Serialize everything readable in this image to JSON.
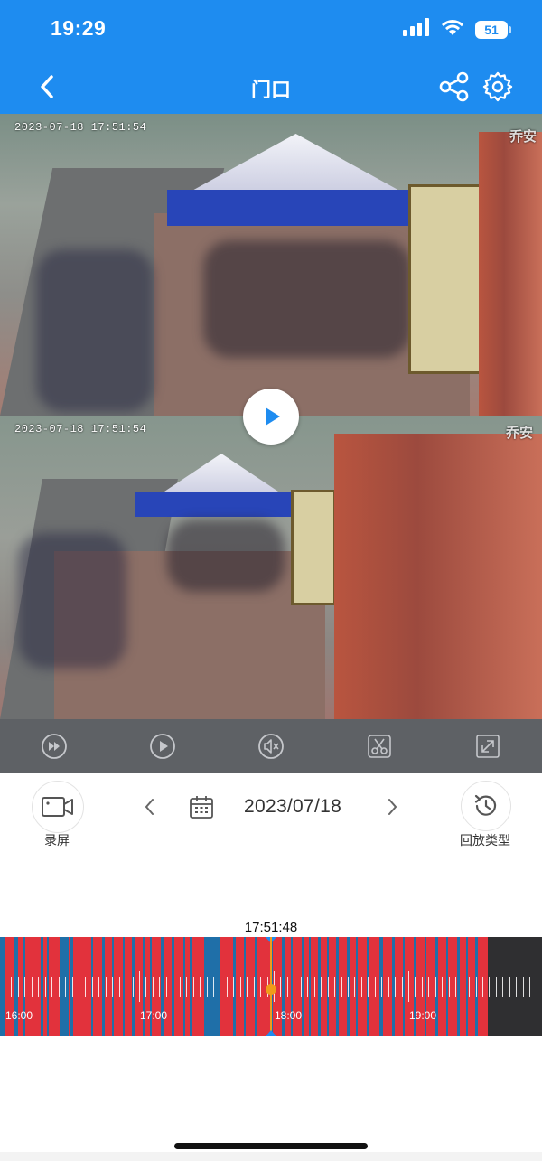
{
  "status_bar": {
    "time": "19:29",
    "battery": "51"
  },
  "header": {
    "title": "门口"
  },
  "video": {
    "feeds": [
      {
        "timestamp": "2023-07-18  17:51:54",
        "watermark": "乔安"
      },
      {
        "timestamp": "2023-07-18  17:51:54",
        "watermark": "乔安"
      }
    ]
  },
  "controls": {
    "record_label": "录屏",
    "date": "2023/07/18",
    "playback_type_label": "回放类型"
  },
  "timeline": {
    "current_time": "17:51:48",
    "labels": [
      "16:00",
      "17:00",
      "18:00",
      "19:00"
    ],
    "recording_color": "#e2323c",
    "event_color": "#1f6fa8",
    "no_data_color": "#2f2f31",
    "cursor_color": "#f09b1a"
  },
  "colors": {
    "accent": "#1e8cf0"
  }
}
